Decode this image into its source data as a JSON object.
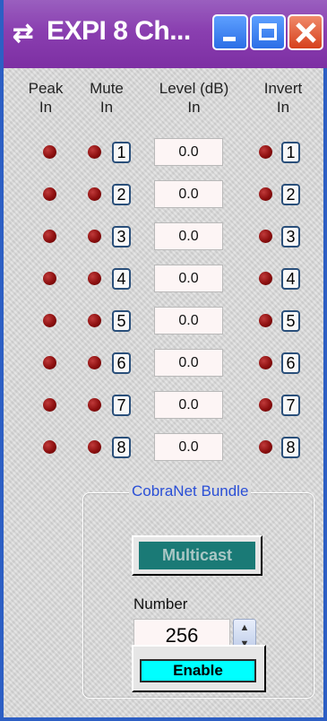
{
  "window": {
    "title": "EXPI 8 Ch...",
    "title_icon": "arrows-icon"
  },
  "headers": {
    "peak": "Peak In",
    "mute": "Mute In",
    "level": "Level (dB) In",
    "invert": "Invert In"
  },
  "channels": [
    {
      "num": "1",
      "level": "0.0"
    },
    {
      "num": "2",
      "level": "0.0"
    },
    {
      "num": "3",
      "level": "0.0"
    },
    {
      "num": "4",
      "level": "0.0"
    },
    {
      "num": "5",
      "level": "0.0"
    },
    {
      "num": "6",
      "level": "0.0"
    },
    {
      "num": "7",
      "level": "0.0"
    },
    {
      "num": "8",
      "level": "0.0"
    }
  ],
  "cobranet": {
    "group_label": "CobraNet Bundle",
    "multicast_label": "Multicast",
    "number_label": "Number",
    "number_value": "256",
    "enable_label": "Enable"
  },
  "colors": {
    "titlebar": "#8a3fb0",
    "led": "#8c0f0f",
    "multicast": "#1a7a76",
    "enable": "#00ffff",
    "group_label": "#2a4fd6"
  }
}
